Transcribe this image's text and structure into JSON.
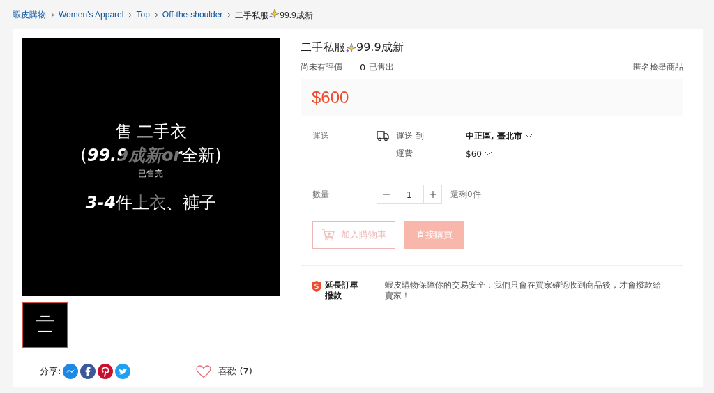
{
  "breadcrumb": {
    "links": [
      "蝦皮購物",
      "Women's Apparel",
      "Top",
      "Off-the-shoulder"
    ],
    "current": {
      "before": "二手私服",
      "after": "99.9成新"
    }
  },
  "gallery": {
    "image_lines": [
      {
        "text": "售 二手衣",
        "kind": "plain"
      },
      {
        "text": "(**99.9成新or**全新)",
        "kind": "rich"
      },
      {
        "text": "**3-4**件上衣、褲子",
        "kind": "rich"
      }
    ],
    "overlay": "已售完",
    "thumbnails": [
      {
        "kind": "picture",
        "selected": true
      }
    ]
  },
  "share": {
    "label": "分享:",
    "icons": [
      {
        "kind": "messenger"
      },
      {
        "kind": "facebook"
      },
      {
        "kind": "pinterest"
      },
      {
        "kind": "twitter"
      }
    ]
  },
  "like": {
    "label": "喜歡 (7)",
    "liked": false
  },
  "product": {
    "title_before": "二手私服",
    "title_after": "99.9成新",
    "rating": "尚未有評價",
    "sold_count": "0",
    "sold_label": "已售出",
    "report": "匿名檢舉商品",
    "price": "$600",
    "shipping": {
      "label": "運送",
      "to_label": "運送 到",
      "destination": "中正區, 臺北市",
      "fee_label": "運費",
      "fee": "$60"
    },
    "quantity": {
      "label": "數量",
      "value": "1",
      "stock": "還剩0件"
    },
    "buttons": [
      {
        "label": "加入購物車",
        "kind": "cart",
        "disabled": true
      },
      {
        "label": "直接購買",
        "kind": "buy",
        "disabled": true
      }
    ],
    "guarantee": {
      "title": "延長訂單撥款",
      "text": "蝦皮購物保障你的交易安全：我們只會在買家確認收到商品後，才會撥款給賣家！"
    }
  }
}
